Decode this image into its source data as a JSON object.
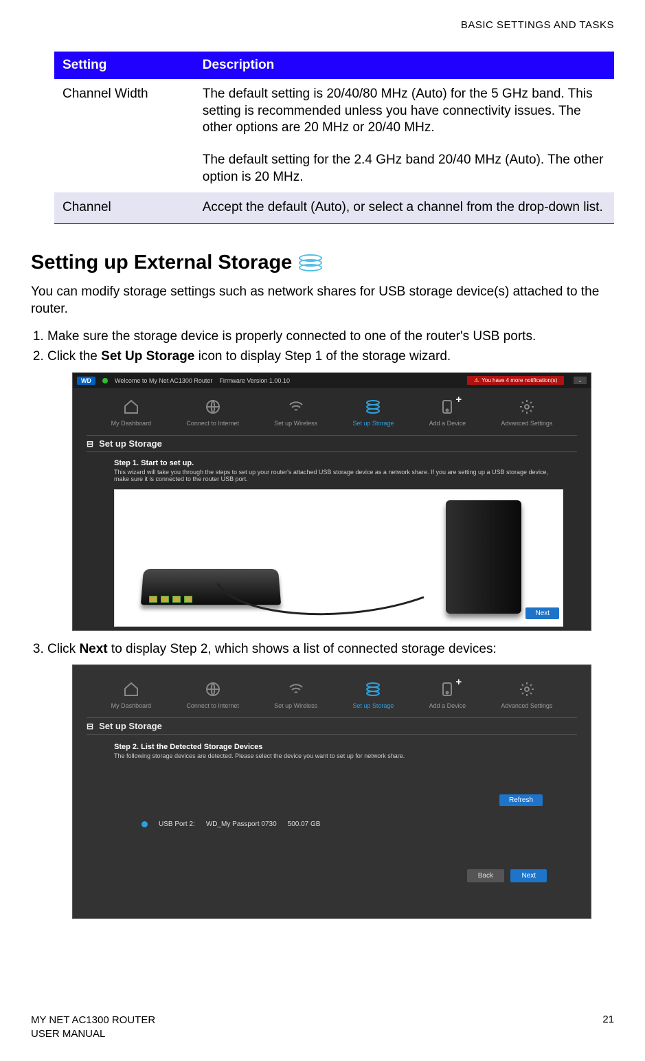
{
  "header": {
    "section_title": "BASIC SETTINGS AND TASKS"
  },
  "table": {
    "headers": {
      "setting": "Setting",
      "description": "Description"
    },
    "rows": [
      {
        "setting": "Channel Width",
        "desc_p1": "The default setting is 20/40/80 MHz (Auto) for the 5 GHz band. This setting is recommended unless you have connectivity issues. The other options are 20 MHz or 20/40 MHz.",
        "desc_p2": "The default setting for the 2.4 GHz band 20/40 MHz (Auto). The other option is 20 MHz."
      },
      {
        "setting": "Channel",
        "desc_p1": "Accept the default (Auto), or select a channel from the drop-down list."
      }
    ]
  },
  "section_heading": "Setting up External Storage",
  "intro": "You can modify storage settings such as network shares for USB storage device(s) attached to the router.",
  "steps": {
    "s1": "Make sure the storage device is properly connected to one of the router's USB ports.",
    "s2_pre": "Click the ",
    "s2_bold": "Set Up Storage",
    "s2_post": " icon to display Step 1 of the storage wizard.",
    "s3_pre": "Click ",
    "s3_bold": "Next",
    "s3_post": " to display Step 2, which shows a list of connected storage devices:"
  },
  "shot1": {
    "logo": "WD",
    "welcome": "Welcome to My Net AC1300 Router",
    "fw": "Firmware Version 1.00.10",
    "notif": "You have 4 more notification(s)",
    "nav": {
      "dash": "My Dashboard",
      "connect": "Connect to Internet",
      "wireless": "Set up Wireless",
      "storage": "Set up Storage",
      "add": "Add a Device",
      "advanced": "Advanced Settings"
    },
    "section_label": "Set up Storage",
    "step_title": "Step 1. Start to set up.",
    "step_body": "This wizard will take you through the steps to set up your router's attached USB storage device as a network share. If you are setting up a USB storage device, make sure it is connected to the router USB port.",
    "next": "Next"
  },
  "shot2": {
    "section_label": "Set up Storage",
    "step_title": "Step 2. List the Detected Storage Devices",
    "step_body": "The following storage devices are detected. Please select the device you want to set up for network share.",
    "refresh": "Refresh",
    "device_port": "USB Port 2:",
    "device_name": "WD_My Passport 0730",
    "device_size": "500.07 GB",
    "back": "Back",
    "next": "Next"
  },
  "footer": {
    "product": "MY NET AC1300 ROUTER",
    "doc": "USER MANUAL",
    "page": "21"
  }
}
